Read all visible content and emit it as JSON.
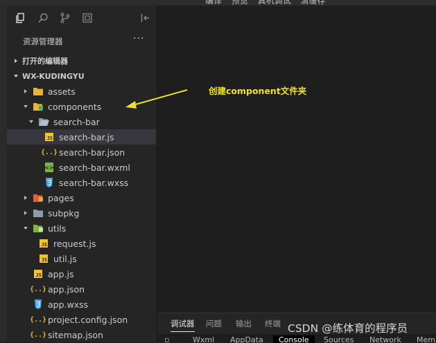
{
  "window": {
    "top_menu": [
      "编译",
      "预览",
      "真机调试",
      "清缓存"
    ]
  },
  "sidebar": {
    "activity_icons": [
      "explorer-icon",
      "search-icon",
      "source-control-icon",
      "extensions-icon",
      "collapse-sidebar-icon"
    ],
    "title": "资源管理器",
    "more": "···",
    "open_editors": "打开的编辑器",
    "project": "WX-KUDINGYU",
    "tree": [
      {
        "label": "assets",
        "kind": "folder"
      },
      {
        "label": "components",
        "kind": "folder-open"
      },
      {
        "label": "search-bar",
        "kind": "folder-open"
      },
      {
        "label": "search-bar.js",
        "kind": "js"
      },
      {
        "label": "search-bar.json",
        "kind": "json"
      },
      {
        "label": "search-bar.wxml",
        "kind": "wxml"
      },
      {
        "label": "search-bar.wxss",
        "kind": "wxss"
      },
      {
        "label": "pages",
        "kind": "folder"
      },
      {
        "label": "subpkg",
        "kind": "folder"
      },
      {
        "label": "utils",
        "kind": "folder-open"
      },
      {
        "label": "request.js",
        "kind": "js"
      },
      {
        "label": "util.js",
        "kind": "js"
      },
      {
        "label": "app.js",
        "kind": "js"
      },
      {
        "label": "app.json",
        "kind": "json"
      },
      {
        "label": "app.wxss",
        "kind": "wxss"
      },
      {
        "label": "project.config.json",
        "kind": "json"
      },
      {
        "label": "sitemap.json",
        "kind": "json"
      }
    ]
  },
  "annotation": {
    "text": "创建component文件夹",
    "color": "#f2e12a"
  },
  "panel": {
    "tabs": [
      "调试器",
      "问题",
      "输出",
      "终端"
    ],
    "subtabs": [
      "Wxml",
      "AppData",
      "Console",
      "Sources",
      "Network",
      "Mem"
    ]
  },
  "watermark": "CSDN @练体育的程序员",
  "colors": {
    "folder": "#e8b43a",
    "utils_folder": "#7cb342",
    "pages_folder": "#e0603d",
    "subpkg_folder": "#8c9eaa",
    "js": "#f1c232",
    "wxss": "#42a5f5",
    "selection": "#37373d"
  }
}
